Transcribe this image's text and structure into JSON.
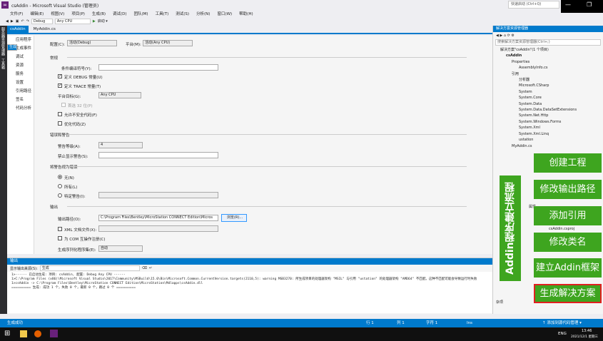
{
  "window": {
    "title": "csAddin - Microsoft Visual Studio (管理员)",
    "quick_launch": "快速启动 (Ctrl+Q)"
  },
  "menu": [
    "文件(F)",
    "编辑(E)",
    "视图(V)",
    "项目(P)",
    "生成(B)",
    "调试(D)",
    "团队(M)",
    "工具(T)",
    "测试(S)",
    "分析(N)",
    "窗口(W)",
    "帮助(H)"
  ],
  "toolbar": {
    "config": "Debug",
    "platform": "Any CPU",
    "start": "启动 ▾"
  },
  "left_tabs": [
    "服务器资源管理器",
    "工具箱"
  ],
  "doc_tabs": [
    "csAddin",
    "MyAddin.cs"
  ],
  "nav": [
    "应用程序",
    "生成",
    "生成事件",
    "调试",
    "资源",
    "服务",
    "设置",
    "引用路径",
    "签名",
    "代码分析"
  ],
  "props": {
    "config_label": "配置(C):",
    "config_value": "活动(Debug)",
    "platform_label": "平台(M):",
    "platform_value": "活动(Any CPU)",
    "general": "常规",
    "cond_label": "条件编译符号(Y):",
    "define_debug": "定义 DEBUG 常量(U)",
    "define_trace": "定义 TRACE 常量(T)",
    "platform_target_label": "平台目标(G):",
    "platform_target_value": "Any CPU",
    "prefer32": "首选 32 位(P)",
    "unsafe": "允许不安全代码(F)",
    "optimize": "优化代码(Z)",
    "errors_section": "错误和警告",
    "warn_level_label": "警告等级(A):",
    "warn_level_value": "4",
    "suppress_label": "禁止显示警告(S):",
    "treat_section": "将警告视为错误",
    "none": "无(N)",
    "all": "所有(L)",
    "specific": "特定警告(I):",
    "output_section": "输出",
    "output_path_label": "输出路径(O):",
    "output_path_value": "C:\\Program Files\\Bentley\\MicroStation CONNECT Edition\\Micros",
    "browse": "浏览(R)...",
    "xml_doc": "XML 文档文件(X):",
    "com_interop": "为 COM 互操作注册(C)",
    "serialize_label": "生成序列化程序集(E):",
    "serialize_value": "自动"
  },
  "output": {
    "title": "输出",
    "show_from": "显示输出来源(S):",
    "source": "生成",
    "lines": [
      "1>------ 已启动生成: 项目: csAddin, 配置: Debug Any CPU ------",
      "1>C:\\Program Files (x86)\\Microsoft Visual Studio\\2017\\Community\\MSBuild\\15.0\\Bin\\Microsoft.Common.CurrentVersion.targets(2110,5): warning MSB3270: 所生成项目的处理器架构 \"MSIL\" 与引用 \"ustation\" 的处理器架构 \"AMD64\" 不匹配。这种不匹配可能会导致运行时失败",
      "1>csAddin -> C:\\Program Files\\Bentley\\MicroStation CONNECT Edition\\MicroStation\\Mdlapps\\csAddin.dll",
      "========== 生成: 成功 1 个，失败 0 个，最新 0 个，跳过 0 个 =========="
    ]
  },
  "solution": {
    "title": "解决方案资源管理器",
    "search": "搜索解决方案资源管理器(Ctrl+;)",
    "tree": [
      "解决方案\"csAddin\"(1 个项目)",
      "csAddin",
      "Properties",
      "AssemblyInfo.cs",
      "引用",
      "分析器",
      "Microsoft.CSharp",
      "System",
      "System.Core",
      "System.Data",
      "System.Data.DataSetExtensions",
      "System.Net.Http",
      "System.Windows.Forms",
      "System.Xml",
      "System.Xml.Linq",
      "ustation",
      "MyAddin.cs"
    ],
    "props_title": "属性",
    "props_file": "csAddin.csproj",
    "misc": "杂项"
  },
  "overlay": {
    "vertical": "Addin程序建立流程",
    "steps": [
      "创建工程",
      "修改输出路径",
      "添加引用",
      "修改类名",
      "建立Addin框架",
      "生成解决方案"
    ],
    "accent": "#3ea51f"
  },
  "status": {
    "left": "生成成功",
    "line": "行 1",
    "col": "列 1",
    "ch": "字符 1",
    "ins": "Ins",
    "right": "↑ 添加到源代码管理 ▾"
  },
  "taskbar": {
    "lang": "ENG",
    "time": "13:46",
    "date": "2021/12/1 星期三"
  }
}
